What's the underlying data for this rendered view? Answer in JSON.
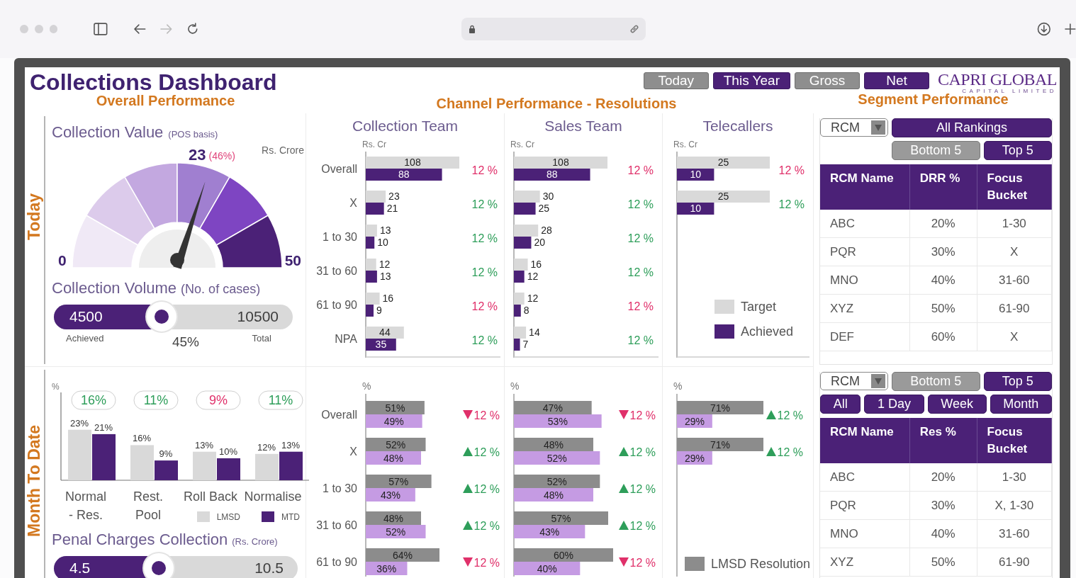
{
  "browser": {
    "back": {
      "disabled": false
    },
    "forward": {
      "disabled": true
    }
  },
  "title": "Collections Dashboard",
  "toggles": [
    {
      "label": "Today",
      "selected": false
    },
    {
      "label": "This Year",
      "selected": true
    },
    {
      "label": "Gross",
      "selected": false
    },
    {
      "label": "Net",
      "selected": true
    }
  ],
  "logo": {
    "name": "CAPRI GLOBAL",
    "tagline": "CAPITAL LIMITED"
  },
  "overall_performance": {
    "title": "Overall Performance",
    "today": {
      "label": "Today",
      "collection_value": {
        "title": "Collection Value",
        "note": "(POS basis)",
        "unit": "Rs. Crore",
        "value": "23",
        "percent": "(46%)",
        "min": "0",
        "max": "50",
        "level": 0.6
      },
      "collection_volume": {
        "title": "Collection Volume",
        "note": "(No. of cases)",
        "achieved": "4500",
        "total": "10500",
        "achieved_label": "Achieved",
        "total_label": "Total",
        "percent": "45%",
        "level": 0.45
      }
    },
    "month_to_date": {
      "label": "Month To Date",
      "badges": [
        {
          "text": "16%",
          "good": true
        },
        {
          "text": "11%",
          "good": true
        },
        {
          "text": "9%",
          "good": false
        },
        {
          "text": "11%",
          "good": true
        }
      ],
      "chart_data": {
        "type": "bar",
        "orientation": "vertical",
        "ylabel": "%",
        "categories": [
          "Normal - Res.",
          "Rest. Pool",
          "Roll Back",
          "Normalise"
        ],
        "series": [
          {
            "name": "LMSD",
            "color": "#d9d9d9",
            "values": [
              23,
              16,
              13,
              12
            ],
            "value_labels": [
              "23%",
              "16%",
              "13%",
              "12%"
            ]
          },
          {
            "name": "MTD",
            "color": "#4b2177",
            "values": [
              21,
              9,
              10,
              13
            ],
            "value_labels": [
              "21%",
              "9%",
              "10%",
              "13%"
            ]
          }
        ],
        "legend": true
      },
      "penal_charges": {
        "title": "Penal Charges Collection",
        "note": "(Rs. Crore)",
        "achieved": "4.5",
        "total": "10.5",
        "level": 0.43
      }
    }
  },
  "channel_performance": {
    "title": "Channel Performance - Resolutions",
    "teams": [
      {
        "name": "Collection Team",
        "value_chart": {
          "chart_data": {
            "type": "bar",
            "orientation": "horizontal",
            "xlabel": "Rs. Cr",
            "categories": [
              "Overall",
              "X",
              "1 to 30",
              "31 to 60",
              "61 to 90",
              "NPA"
            ],
            "series": [
              {
                "color": "#d9d9d9",
                "values": [
                  108,
                  23,
                  13,
                  12,
                  16,
                  44
                ]
              },
              {
                "color": "#4b2177",
                "values": [
                  88,
                  21,
                  10,
                  13,
                  9,
                  35
                ]
              }
            ],
            "data_labels": true
          },
          "changes": [
            {
              "text": "12 %",
              "color": "#e0306a"
            },
            {
              "text": "12 %",
              "color": "#2e9e5a"
            },
            {
              "text": "12 %",
              "color": "#2e9e5a"
            },
            {
              "text": "12 %",
              "color": "#2e9e5a"
            },
            {
              "text": "12 %",
              "color": "#e0306a"
            },
            {
              "text": "12 %",
              "color": "#2e9e5a"
            }
          ]
        },
        "resolution_chart": {
          "chart_data": {
            "type": "bar",
            "orientation": "horizontal",
            "xlabel": "%",
            "categories": [
              "Overall",
              "X",
              "1 to 30",
              "31 to 60",
              "61 to 90"
            ],
            "series": [
              {
                "color": "#8c8c8c",
                "values": [
                  51,
                  52,
                  57,
                  48,
                  64
                ],
                "value_labels": [
                  "51%",
                  "52%",
                  "57%",
                  "48%",
                  "64%"
                ]
              },
              {
                "color": "#c59be3",
                "values": [
                  49,
                  48,
                  43,
                  52,
                  36
                ],
                "value_labels": [
                  "49%",
                  "48%",
                  "43%",
                  "52%",
                  "36%"
                ]
              }
            ]
          },
          "changes": [
            {
              "text": "12 %",
              "up": false
            },
            {
              "text": "12 %",
              "up": true
            },
            {
              "text": "12 %",
              "up": true
            },
            {
              "text": "12 %",
              "up": true
            },
            {
              "text": "12 %",
              "up": false
            }
          ]
        }
      },
      {
        "name": "Sales Team",
        "value_chart": {
          "chart_data": {
            "type": "bar",
            "orientation": "horizontal",
            "xlabel": "Rs. Cr",
            "categories": [
              null,
              null,
              null,
              null,
              null,
              null
            ],
            "series": [
              {
                "color": "#d9d9d9",
                "values": [
                  108,
                  30,
                  28,
                  16,
                  12,
                  14
                ]
              },
              {
                "color": "#4b2177",
                "values": [
                  88,
                  25,
                  20,
                  12,
                  8,
                  7
                ]
              }
            ],
            "data_labels": true
          },
          "changes": [
            {
              "text": "12 %",
              "color": "#e0306a"
            },
            {
              "text": "12 %",
              "color": "#2e9e5a"
            },
            {
              "text": "12 %",
              "color": "#2e9e5a"
            },
            {
              "text": "12 %",
              "color": "#2e9e5a"
            },
            {
              "text": "12 %",
              "color": "#e0306a"
            },
            {
              "text": "12 %",
              "color": "#2e9e5a"
            }
          ]
        },
        "resolution_chart": {
          "chart_data": {
            "type": "bar",
            "orientation": "horizontal",
            "xlabel": "%",
            "categories": [
              null,
              null,
              null,
              null,
              null
            ],
            "series": [
              {
                "color": "#8c8c8c",
                "values": [
                  47,
                  48,
                  52,
                  57,
                  60
                ],
                "value_labels": [
                  "47%",
                  "48%",
                  "52%",
                  "57%",
                  "60%"
                ]
              },
              {
                "color": "#c59be3",
                "values": [
                  53,
                  52,
                  48,
                  43,
                  40
                ],
                "value_labels": [
                  "53%",
                  "52%",
                  "48%",
                  "43%",
                  "40%"
                ]
              }
            ]
          },
          "changes": [
            {
              "text": "12 %",
              "up": false
            },
            {
              "text": "12 %",
              "up": true
            },
            {
              "text": "12 %",
              "up": true
            },
            {
              "text": "12 %",
              "up": true
            },
            {
              "text": "12 %",
              "up": false
            }
          ]
        }
      },
      {
        "name": "Telecallers",
        "value_chart": {
          "chart_data": {
            "type": "bar",
            "orientation": "horizontal",
            "xlabel": "Rs. Cr",
            "categories": [
              null,
              null
            ],
            "series": [
              {
                "name": "Target",
                "color": "#d9d9d9",
                "values": [
                  25,
                  25
                ]
              },
              {
                "name": "Achieved",
                "color": "#4b2177",
                "values": [
                  10,
                  10
                ]
              }
            ],
            "data_labels": true,
            "legend": true
          },
          "changes": [
            {
              "text": "12 %",
              "color": "#e0306a"
            },
            {
              "text": "12 %",
              "color": "#2e9e5a"
            }
          ]
        },
        "resolution_chart": {
          "chart_data": {
            "type": "bar",
            "orientation": "horizontal",
            "xlabel": "%",
            "categories": [
              null,
              null
            ],
            "series": [
              {
                "name": "LMSD Resolution",
                "color": "#8c8c8c",
                "values": [
                  71,
                  71
                ],
                "value_labels": [
                  "71%",
                  "71%"
                ]
              },
              {
                "color": "#c59be3",
                "values": [
                  29,
                  29
                ],
                "value_labels": [
                  "29%",
                  "29%"
                ]
              }
            ],
            "legend": true
          },
          "changes": [
            {
              "text": "12 %",
              "up": true
            },
            {
              "text": "12 %",
              "up": true
            }
          ]
        }
      }
    ]
  },
  "segment_performance": {
    "title": "Segment Performance",
    "panels": [
      {
        "dropdown": "RCM",
        "button_rows": [
          [
            {
              "label": "All Rankings",
              "selected": true
            }
          ],
          [
            {
              "label": "Bottom 5",
              "selected": false
            },
            {
              "label": "Top 5",
              "selected": true
            }
          ]
        ],
        "table": {
          "columns": [
            "RCM Name",
            "DRR %",
            "Focus Bucket"
          ],
          "rows": [
            [
              "ABC",
              "20%",
              "1-30"
            ],
            [
              "PQR",
              "30%",
              "X"
            ],
            [
              "MNO",
              "40%",
              "31-60"
            ],
            [
              "XYZ",
              "50%",
              "61-90"
            ],
            [
              "DEF",
              "60%",
              "X"
            ]
          ]
        }
      },
      {
        "dropdown": "RCM",
        "button_rows": [
          [
            {
              "label": "Bottom 5",
              "selected": false
            },
            {
              "label": "Top 5",
              "selected": true
            }
          ],
          [
            {
              "label": "All",
              "selected": true
            },
            {
              "label": "1 Day",
              "selected": true
            },
            {
              "label": "Week",
              "selected": true
            },
            {
              "label": "Month",
              "selected": true
            }
          ]
        ],
        "table": {
          "columns": [
            "RCM Name",
            "Res %",
            "Focus Bucket"
          ],
          "rows": [
            [
              "ABC",
              "20%",
              "1-30"
            ],
            [
              "PQR",
              "30%",
              "X, 1-30"
            ],
            [
              "MNO",
              "40%",
              "31-60"
            ],
            [
              "XYZ",
              "50%",
              "61-90"
            ]
          ]
        }
      }
    ]
  }
}
